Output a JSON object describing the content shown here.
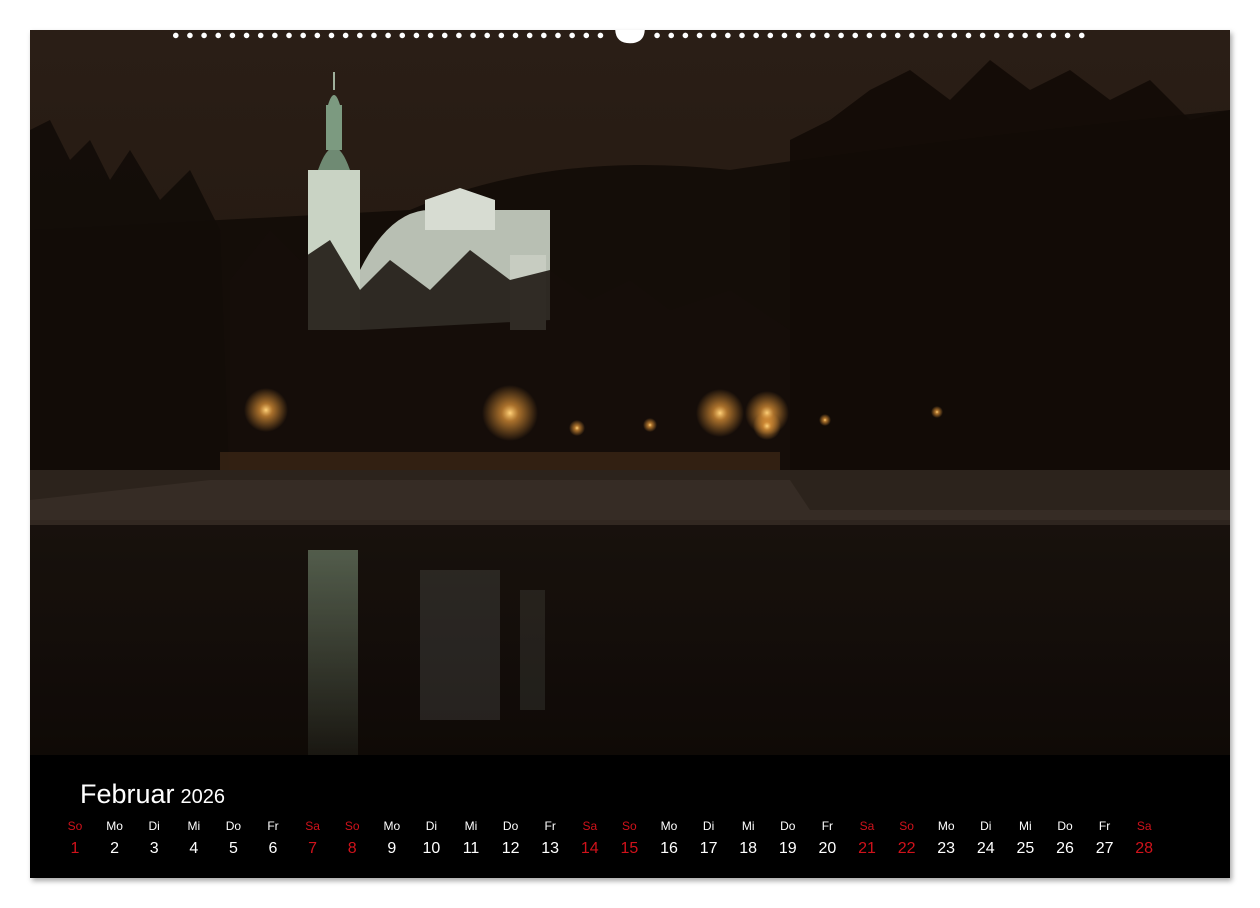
{
  "calendar": {
    "month": "Februar",
    "year": "2026",
    "days": [
      {
        "wd": "So",
        "day": "1",
        "weekend": true
      },
      {
        "wd": "Mo",
        "day": "2",
        "weekend": false
      },
      {
        "wd": "Di",
        "day": "3",
        "weekend": false
      },
      {
        "wd": "Mi",
        "day": "4",
        "weekend": false
      },
      {
        "wd": "Do",
        "day": "5",
        "weekend": false
      },
      {
        "wd": "Fr",
        "day": "6",
        "weekend": false
      },
      {
        "wd": "Sa",
        "day": "7",
        "weekend": true
      },
      {
        "wd": "So",
        "day": "8",
        "weekend": true
      },
      {
        "wd": "Mo",
        "day": "9",
        "weekend": false
      },
      {
        "wd": "Di",
        "day": "10",
        "weekend": false
      },
      {
        "wd": "Mi",
        "day": "11",
        "weekend": false
      },
      {
        "wd": "Do",
        "day": "12",
        "weekend": false
      },
      {
        "wd": "Fr",
        "day": "13",
        "weekend": false
      },
      {
        "wd": "Sa",
        "day": "14",
        "weekend": true
      },
      {
        "wd": "So",
        "day": "15",
        "weekend": true
      },
      {
        "wd": "Mo",
        "day": "16",
        "weekend": false
      },
      {
        "wd": "Di",
        "day": "17",
        "weekend": false
      },
      {
        "wd": "Mi",
        "day": "18",
        "weekend": false
      },
      {
        "wd": "Do",
        "day": "19",
        "weekend": false
      },
      {
        "wd": "Fr",
        "day": "20",
        "weekend": false
      },
      {
        "wd": "Sa",
        "day": "21",
        "weekend": true
      },
      {
        "wd": "So",
        "day": "22",
        "weekend": true
      },
      {
        "wd": "Mo",
        "day": "23",
        "weekend": false
      },
      {
        "wd": "Di",
        "day": "24",
        "weekend": false
      },
      {
        "wd": "Mi",
        "day": "25",
        "weekend": false
      },
      {
        "wd": "Do",
        "day": "26",
        "weekend": false
      },
      {
        "wd": "Fr",
        "day": "27",
        "weekend": false
      },
      {
        "wd": "Sa",
        "day": "28",
        "weekend": true
      }
    ]
  },
  "colors": {
    "weekend": "#d0121b",
    "weekday": "#ffffff",
    "background": "#000000"
  }
}
